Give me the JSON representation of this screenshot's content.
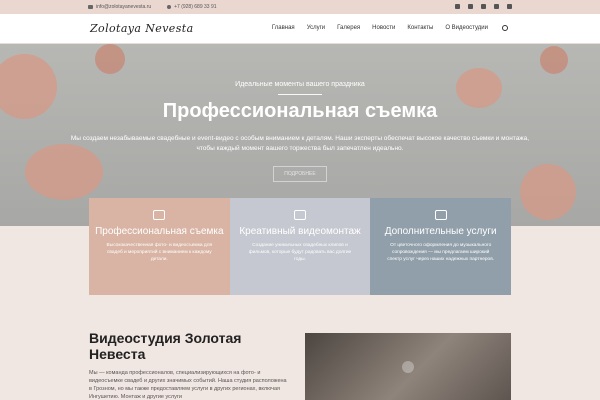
{
  "topbar": {
    "email": "info@zolotayanevesta.ru",
    "phone": "+7 (928) 689 33 91"
  },
  "nav": {
    "logo": "Zolotaya Nevesta",
    "items": [
      {
        "label": "Главная"
      },
      {
        "label": "Услуги"
      },
      {
        "label": "Галерея"
      },
      {
        "label": "Новости"
      },
      {
        "label": "Контакты"
      },
      {
        "label": "О Видеостудии"
      }
    ]
  },
  "hero": {
    "kicker": "Идеальные моменты вашего праздника",
    "title": "Профессиональная съемка",
    "description": "Мы создаем незабываемые свадебные и event-видео с особым вниманием к деталям. Наши эксперты обеспечат высокое качество съемки и монтажа, чтобы каждый момент вашего торжества был запечатлен идеально.",
    "button": "ПОДРОБНЕЕ"
  },
  "cards": [
    {
      "title": "Профессиональная съемка",
      "text": "Высококачественная фото- и видеосъемка для свадеб и мероприятий с вниманием к каждому детали.",
      "color": "#d9b4a4"
    },
    {
      "title": "Креативный видеомонтаж",
      "text": "Создание уникальных свадебных клипов и фильмов, которые будут радовать вас долгие годы.",
      "color": "#c5c8d0"
    },
    {
      "title": "Дополнительные услуги",
      "text": "От цветочного оформления до музыкального сопровождения — мы предлагаем широкий спектр услуг через наших надежных партнеров.",
      "color": "#919faa"
    }
  ],
  "about": {
    "title": "Видеостудия Золотая Невеста",
    "text": "Мы — команда профессионалов, специализирующихся на фото- и видеосъемке свадеб и других значимых событий. Наша студия расположена в Грозном, но мы также предоставляем услуги в других регионах, включая Ингушетию. Монтаж и другие услуги"
  }
}
